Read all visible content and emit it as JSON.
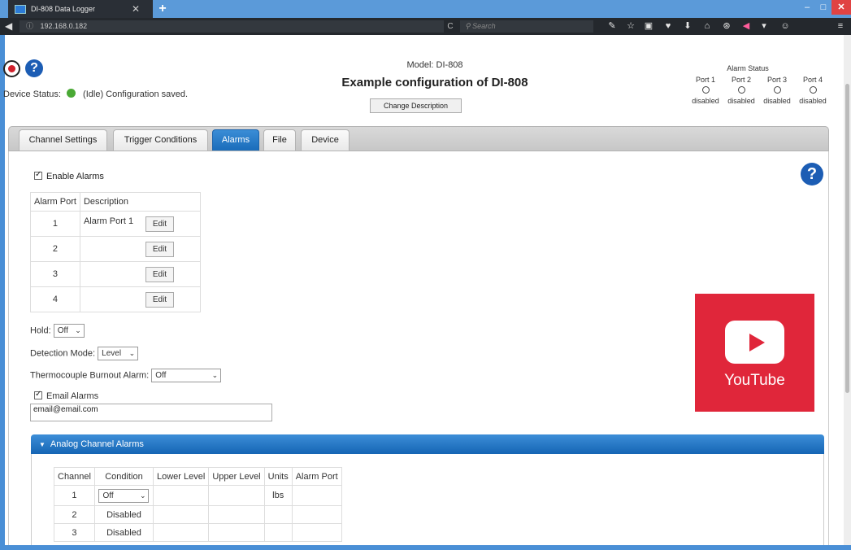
{
  "browser": {
    "tab_title": "DI-808 Data Logger",
    "tab_close": "✕",
    "new_tab": "+",
    "url": "192.168.0.182",
    "search_placeholder": "Search",
    "window_min": "–",
    "window_max": "□",
    "window_close": "✕"
  },
  "header": {
    "device_status_label": "Device Status:",
    "device_status_text": "(Idle)  Configuration saved.",
    "model": "Model: DI-808",
    "config_title": "Example configuration of DI-808",
    "change_description_label": "Change Description",
    "alarm_status_title": "Alarm Status",
    "alarm_ports": [
      {
        "label": "Port 1",
        "state": "disabled"
      },
      {
        "label": "Port 2",
        "state": "disabled"
      },
      {
        "label": "Port 3",
        "state": "disabled"
      },
      {
        "label": "Port 4",
        "state": "disabled"
      }
    ],
    "status_color": "#4aa935"
  },
  "tabs": [
    {
      "label": "Channel Settings",
      "active": false
    },
    {
      "label": "Trigger Conditions",
      "active": false
    },
    {
      "label": "Alarms",
      "active": true
    },
    {
      "label": "File",
      "active": false
    },
    {
      "label": "Device",
      "active": false
    }
  ],
  "alarms": {
    "enable_label": "Enable Alarms",
    "enabled": true,
    "table_headers": [
      "Alarm Port",
      "Description"
    ],
    "ports": [
      {
        "port": "1",
        "description": "Alarm Port 1",
        "edit": "Edit"
      },
      {
        "port": "2",
        "description": "",
        "edit": "Edit"
      },
      {
        "port": "3",
        "description": "",
        "edit": "Edit"
      },
      {
        "port": "4",
        "description": "",
        "edit": "Edit"
      }
    ],
    "hold_label": "Hold:",
    "hold_value": "Off",
    "detection_label": "Detection Mode:",
    "detection_value": "Level",
    "burnout_label": "Thermocouple Burnout Alarm:",
    "burnout_value": "Off",
    "email_label": "Email Alarms",
    "email_enabled": true,
    "email_value": "email@email.com"
  },
  "analog": {
    "title": "Analog Channel Alarms",
    "headers": [
      "Channel",
      "Condition",
      "Lower Level",
      "Upper Level",
      "Units",
      "Alarm Port"
    ],
    "rows": [
      {
        "channel": "1",
        "condition": "Off",
        "lower": "",
        "upper": "",
        "units": "lbs",
        "port": ""
      },
      {
        "channel": "2",
        "condition": "Disabled",
        "lower": "",
        "upper": "",
        "units": "",
        "port": ""
      },
      {
        "channel": "3",
        "condition": "Disabled",
        "lower": "",
        "upper": "",
        "units": "",
        "port": ""
      }
    ]
  },
  "youtube": {
    "label": "YouTube",
    "color": "#e0263a"
  },
  "accent_color": "#1a6cba"
}
